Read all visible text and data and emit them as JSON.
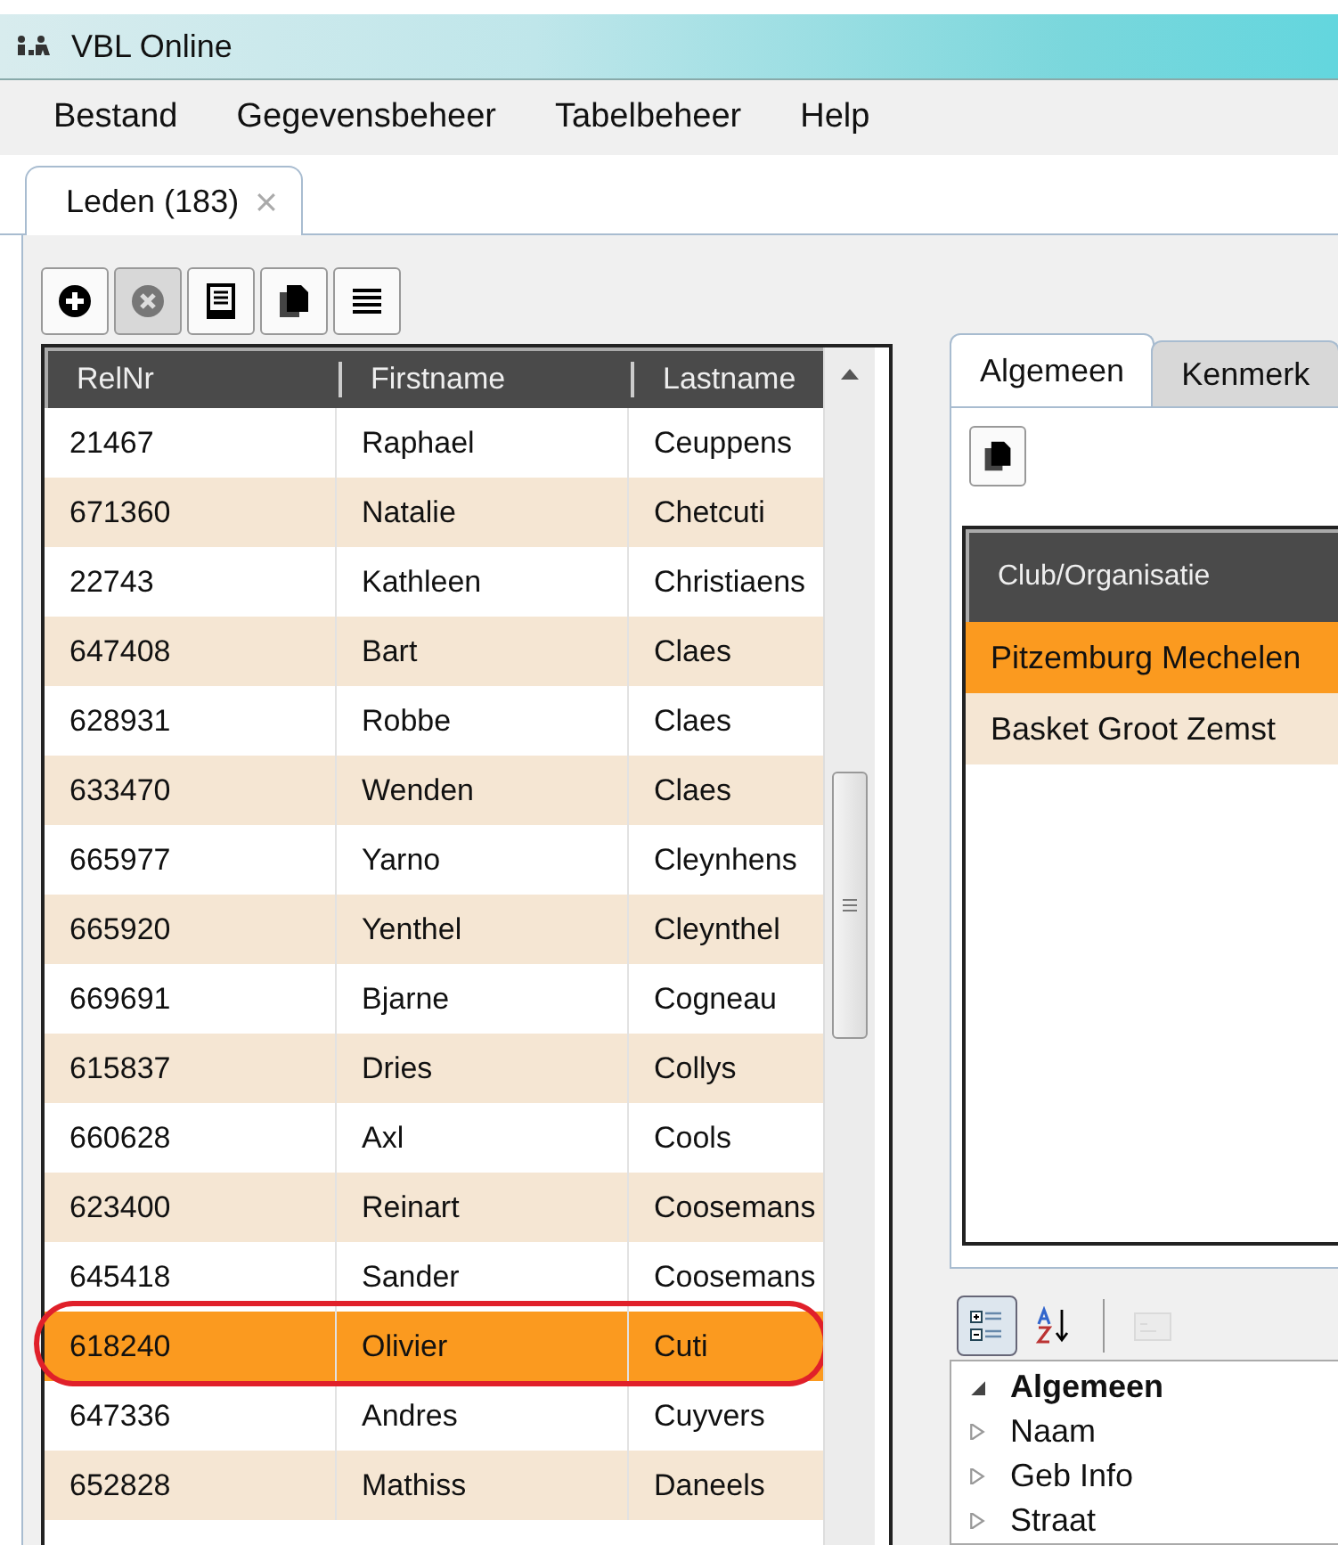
{
  "window": {
    "title": "VBL Online"
  },
  "menu": [
    "Bestand",
    "Gegevensbeheer",
    "Tabelbeheer",
    "Help"
  ],
  "tabs": [
    {
      "label": "Leden (183)",
      "selected": true
    }
  ],
  "toolbar": [
    {
      "kind": "add",
      "disabled": false
    },
    {
      "kind": "remove",
      "disabled": true
    },
    {
      "kind": "details",
      "disabled": false
    },
    {
      "kind": "copy",
      "disabled": false
    },
    {
      "kind": "list",
      "disabled": false
    }
  ],
  "members": {
    "columns": [
      "RelNr",
      "Firstname",
      "Lastname"
    ],
    "rows": [
      {
        "cells": [
          "21467",
          "Raphael",
          "Ceuppens"
        ],
        "selected": false
      },
      {
        "cells": [
          "671360",
          "Natalie",
          "Chetcuti"
        ],
        "selected": false
      },
      {
        "cells": [
          "22743",
          "Kathleen",
          "Christiaens"
        ],
        "selected": false
      },
      {
        "cells": [
          "647408",
          "Bart",
          "Claes"
        ],
        "selected": false
      },
      {
        "cells": [
          "628931",
          "Robbe",
          "Claes"
        ],
        "selected": false
      },
      {
        "cells": [
          "633470",
          "Wenden",
          "Claes"
        ],
        "selected": false
      },
      {
        "cells": [
          "665977",
          "Yarno",
          "Cleynhens"
        ],
        "selected": false
      },
      {
        "cells": [
          "665920",
          "Yenthel",
          "Cleynthel"
        ],
        "selected": false
      },
      {
        "cells": [
          "669691",
          "Bjarne",
          "Cogneau"
        ],
        "selected": false
      },
      {
        "cells": [
          "615837",
          "Dries",
          "Collys"
        ],
        "selected": false
      },
      {
        "cells": [
          "660628",
          "Axl",
          "Cools"
        ],
        "selected": false
      },
      {
        "cells": [
          "623400",
          "Reinart",
          "Coosemans"
        ],
        "selected": false
      },
      {
        "cells": [
          "645418",
          "Sander",
          "Coosemans"
        ],
        "selected": false
      },
      {
        "cells": [
          "618240",
          "Olivier",
          "Cuti"
        ],
        "selected": true
      },
      {
        "cells": [
          "647336",
          "Andres",
          "Cuyvers"
        ],
        "selected": false
      },
      {
        "cells": [
          "652828",
          "Mathiss",
          "Daneels"
        ],
        "selected": false
      }
    ]
  },
  "detail_tabs": [
    {
      "label": "Algemeen",
      "selected": true
    },
    {
      "label": "Kenmerk",
      "selected": false
    }
  ],
  "clubs": {
    "columns": [
      "Club/Organisatie"
    ],
    "rows": [
      {
        "name": "Pitzemburg Mechelen",
        "selected": true
      },
      {
        "name": "Basket Groot Zemst",
        "selected": false
      }
    ]
  },
  "property_toolbar": [
    {
      "kind": "categorized",
      "selected": true,
      "disabled": false
    },
    {
      "kind": "alphabetical",
      "selected": false,
      "disabled": false
    },
    {
      "kind": "pages",
      "selected": false,
      "disabled": true
    }
  ],
  "properties": [
    {
      "label": "Algemeen",
      "expanded": true,
      "children": [
        {
          "label": "Naam",
          "expanded": false
        },
        {
          "label": "Geb Info",
          "expanded": false
        },
        {
          "label": "Straat",
          "expanded": false
        }
      ]
    }
  ]
}
